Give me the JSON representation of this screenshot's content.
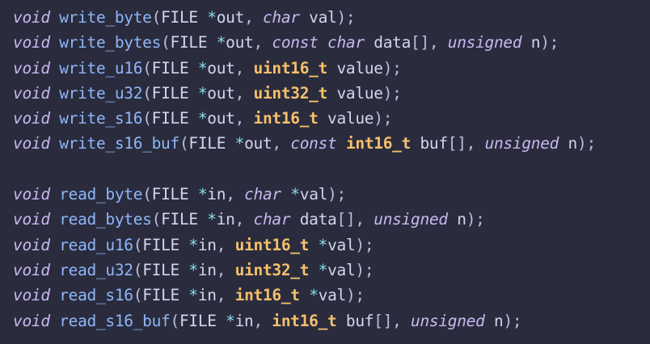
{
  "colors": {
    "background": "#2a2c3e",
    "keyword": "#c8b8f0",
    "function": "#8fb6f8",
    "punctuation": "#b9bfdc",
    "identifier": "#d2d6ec",
    "operator": "#89dceb",
    "type": "#f6c069"
  },
  "lines": [
    [
      {
        "t": "void",
        "c": "kw"
      },
      {
        "t": " ",
        "c": "id"
      },
      {
        "t": "write_byte",
        "c": "fn"
      },
      {
        "t": "(",
        "c": "punc"
      },
      {
        "t": "FILE ",
        "c": "id"
      },
      {
        "t": "*",
        "c": "op"
      },
      {
        "t": "out",
        "c": "id"
      },
      {
        "t": ", ",
        "c": "punc"
      },
      {
        "t": "char",
        "c": "typei"
      },
      {
        "t": " val",
        "c": "id"
      },
      {
        "t": ");",
        "c": "punc"
      }
    ],
    [
      {
        "t": "void",
        "c": "kw"
      },
      {
        "t": " ",
        "c": "id"
      },
      {
        "t": "write_bytes",
        "c": "fn"
      },
      {
        "t": "(",
        "c": "punc"
      },
      {
        "t": "FILE ",
        "c": "id"
      },
      {
        "t": "*",
        "c": "op"
      },
      {
        "t": "out",
        "c": "id"
      },
      {
        "t": ", ",
        "c": "punc"
      },
      {
        "t": "const",
        "c": "kw"
      },
      {
        "t": " ",
        "c": "id"
      },
      {
        "t": "char",
        "c": "typei"
      },
      {
        "t": " data",
        "c": "id"
      },
      {
        "t": "[]",
        "c": "punc"
      },
      {
        "t": ", ",
        "c": "punc"
      },
      {
        "t": "unsigned",
        "c": "typei"
      },
      {
        "t": " n",
        "c": "id"
      },
      {
        "t": ");",
        "c": "punc"
      }
    ],
    [
      {
        "t": "void",
        "c": "kw"
      },
      {
        "t": " ",
        "c": "id"
      },
      {
        "t": "write_u16",
        "c": "fn"
      },
      {
        "t": "(",
        "c": "punc"
      },
      {
        "t": "FILE ",
        "c": "id"
      },
      {
        "t": "*",
        "c": "op"
      },
      {
        "t": "out",
        "c": "id"
      },
      {
        "t": ", ",
        "c": "punc"
      },
      {
        "t": "uint16_t",
        "c": "type"
      },
      {
        "t": " value",
        "c": "id"
      },
      {
        "t": ");",
        "c": "punc"
      }
    ],
    [
      {
        "t": "void",
        "c": "kw"
      },
      {
        "t": " ",
        "c": "id"
      },
      {
        "t": "write_u32",
        "c": "fn"
      },
      {
        "t": "(",
        "c": "punc"
      },
      {
        "t": "FILE ",
        "c": "id"
      },
      {
        "t": "*",
        "c": "op"
      },
      {
        "t": "out",
        "c": "id"
      },
      {
        "t": ", ",
        "c": "punc"
      },
      {
        "t": "uint32_t",
        "c": "type"
      },
      {
        "t": " value",
        "c": "id"
      },
      {
        "t": ");",
        "c": "punc"
      }
    ],
    [
      {
        "t": "void",
        "c": "kw"
      },
      {
        "t": " ",
        "c": "id"
      },
      {
        "t": "write_s16",
        "c": "fn"
      },
      {
        "t": "(",
        "c": "punc"
      },
      {
        "t": "FILE ",
        "c": "id"
      },
      {
        "t": "*",
        "c": "op"
      },
      {
        "t": "out",
        "c": "id"
      },
      {
        "t": ", ",
        "c": "punc"
      },
      {
        "t": "int16_t",
        "c": "type"
      },
      {
        "t": " value",
        "c": "id"
      },
      {
        "t": ");",
        "c": "punc"
      }
    ],
    [
      {
        "t": "void",
        "c": "kw"
      },
      {
        "t": " ",
        "c": "id"
      },
      {
        "t": "write_s16_buf",
        "c": "fn"
      },
      {
        "t": "(",
        "c": "punc"
      },
      {
        "t": "FILE ",
        "c": "id"
      },
      {
        "t": "*",
        "c": "op"
      },
      {
        "t": "out",
        "c": "id"
      },
      {
        "t": ", ",
        "c": "punc"
      },
      {
        "t": "const",
        "c": "kw"
      },
      {
        "t": " ",
        "c": "id"
      },
      {
        "t": "int16_t",
        "c": "type"
      },
      {
        "t": " buf",
        "c": "id"
      },
      {
        "t": "[]",
        "c": "punc"
      },
      {
        "t": ", ",
        "c": "punc"
      },
      {
        "t": "unsigned",
        "c": "typei"
      },
      {
        "t": " n",
        "c": "id"
      },
      {
        "t": ");",
        "c": "punc"
      }
    ],
    [],
    [
      {
        "t": "void",
        "c": "kw"
      },
      {
        "t": " ",
        "c": "id"
      },
      {
        "t": "read_byte",
        "c": "fn"
      },
      {
        "t": "(",
        "c": "punc"
      },
      {
        "t": "FILE ",
        "c": "id"
      },
      {
        "t": "*",
        "c": "op"
      },
      {
        "t": "in",
        "c": "id"
      },
      {
        "t": ", ",
        "c": "punc"
      },
      {
        "t": "char",
        "c": "typei"
      },
      {
        "t": " ",
        "c": "id"
      },
      {
        "t": "*",
        "c": "op"
      },
      {
        "t": "val",
        "c": "id"
      },
      {
        "t": ");",
        "c": "punc"
      }
    ],
    [
      {
        "t": "void",
        "c": "kw"
      },
      {
        "t": " ",
        "c": "id"
      },
      {
        "t": "read_bytes",
        "c": "fn"
      },
      {
        "t": "(",
        "c": "punc"
      },
      {
        "t": "FILE ",
        "c": "id"
      },
      {
        "t": "*",
        "c": "op"
      },
      {
        "t": "in",
        "c": "id"
      },
      {
        "t": ", ",
        "c": "punc"
      },
      {
        "t": "char",
        "c": "typei"
      },
      {
        "t": " data",
        "c": "id"
      },
      {
        "t": "[]",
        "c": "punc"
      },
      {
        "t": ", ",
        "c": "punc"
      },
      {
        "t": "unsigned",
        "c": "typei"
      },
      {
        "t": " n",
        "c": "id"
      },
      {
        "t": ");",
        "c": "punc"
      }
    ],
    [
      {
        "t": "void",
        "c": "kw"
      },
      {
        "t": " ",
        "c": "id"
      },
      {
        "t": "read_u16",
        "c": "fn"
      },
      {
        "t": "(",
        "c": "punc"
      },
      {
        "t": "FILE ",
        "c": "id"
      },
      {
        "t": "*",
        "c": "op"
      },
      {
        "t": "in",
        "c": "id"
      },
      {
        "t": ", ",
        "c": "punc"
      },
      {
        "t": "uint16_t",
        "c": "type"
      },
      {
        "t": " ",
        "c": "id"
      },
      {
        "t": "*",
        "c": "op"
      },
      {
        "t": "val",
        "c": "id"
      },
      {
        "t": ");",
        "c": "punc"
      }
    ],
    [
      {
        "t": "void",
        "c": "kw"
      },
      {
        "t": " ",
        "c": "id"
      },
      {
        "t": "read_u32",
        "c": "fn"
      },
      {
        "t": "(",
        "c": "punc"
      },
      {
        "t": "FILE ",
        "c": "id"
      },
      {
        "t": "*",
        "c": "op"
      },
      {
        "t": "in",
        "c": "id"
      },
      {
        "t": ", ",
        "c": "punc"
      },
      {
        "t": "uint32_t",
        "c": "type"
      },
      {
        "t": " ",
        "c": "id"
      },
      {
        "t": "*",
        "c": "op"
      },
      {
        "t": "val",
        "c": "id"
      },
      {
        "t": ");",
        "c": "punc"
      }
    ],
    [
      {
        "t": "void",
        "c": "kw"
      },
      {
        "t": " ",
        "c": "id"
      },
      {
        "t": "read_s16",
        "c": "fn"
      },
      {
        "t": "(",
        "c": "punc"
      },
      {
        "t": "FILE ",
        "c": "id"
      },
      {
        "t": "*",
        "c": "op"
      },
      {
        "t": "in",
        "c": "id"
      },
      {
        "t": ", ",
        "c": "punc"
      },
      {
        "t": "int16_t",
        "c": "type"
      },
      {
        "t": " ",
        "c": "id"
      },
      {
        "t": "*",
        "c": "op"
      },
      {
        "t": "val",
        "c": "id"
      },
      {
        "t": ");",
        "c": "punc"
      }
    ],
    [
      {
        "t": "void",
        "c": "kw"
      },
      {
        "t": " ",
        "c": "id"
      },
      {
        "t": "read_s16_buf",
        "c": "fn"
      },
      {
        "t": "(",
        "c": "punc"
      },
      {
        "t": "FILE ",
        "c": "id"
      },
      {
        "t": "*",
        "c": "op"
      },
      {
        "t": "in",
        "c": "id"
      },
      {
        "t": ", ",
        "c": "punc"
      },
      {
        "t": "int16_t",
        "c": "type"
      },
      {
        "t": " buf",
        "c": "id"
      },
      {
        "t": "[]",
        "c": "punc"
      },
      {
        "t": ", ",
        "c": "punc"
      },
      {
        "t": "unsigned",
        "c": "typei"
      },
      {
        "t": " n",
        "c": "id"
      },
      {
        "t": ");",
        "c": "punc"
      }
    ]
  ]
}
